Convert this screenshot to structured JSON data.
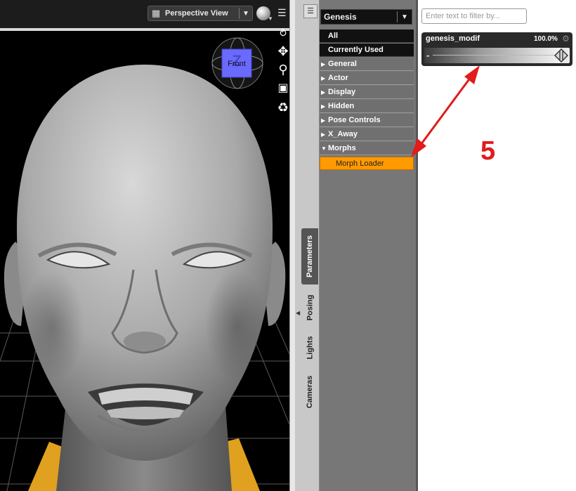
{
  "viewport": {
    "view_label": "Perspective View",
    "view_icon": "camera-view-icon",
    "gizmo_label": "Front",
    "gizmo_axis": "Z",
    "tools": [
      "rotate-icon",
      "pan-icon",
      "zoom-icon",
      "frame-icon",
      "orbit-icon"
    ]
  },
  "side_tabs": {
    "menu_icon": "pane-menu-icon",
    "tabs": [
      {
        "label": "Parameters",
        "active": true
      },
      {
        "label": "Posing",
        "active": false
      },
      {
        "label": "Lights",
        "active": false
      },
      {
        "label": "Cameras",
        "active": false
      }
    ]
  },
  "tree": {
    "node": "Genesis",
    "top_items": [
      "All",
      "Currently Used"
    ],
    "groups": [
      {
        "label": "General",
        "expanded": false
      },
      {
        "label": "Actor",
        "expanded": false
      },
      {
        "label": "Display",
        "expanded": false
      },
      {
        "label": "Hidden",
        "expanded": false
      },
      {
        "label": "Pose Controls",
        "expanded": false
      },
      {
        "label": "X_Away",
        "expanded": false
      },
      {
        "label": "Morphs",
        "expanded": true
      }
    ],
    "selected_child": "Morph Loader"
  },
  "params": {
    "filter_placeholder": "Enter text to filter by...",
    "slider": {
      "name": "genesis_modif",
      "value_label": "100.0%",
      "value": 1.0,
      "minus": "-"
    }
  },
  "annotation": {
    "step": "5",
    "color": "#e21b1b"
  },
  "colors": {
    "highlight": "#ff9a00",
    "tree_bg": "#777777"
  }
}
